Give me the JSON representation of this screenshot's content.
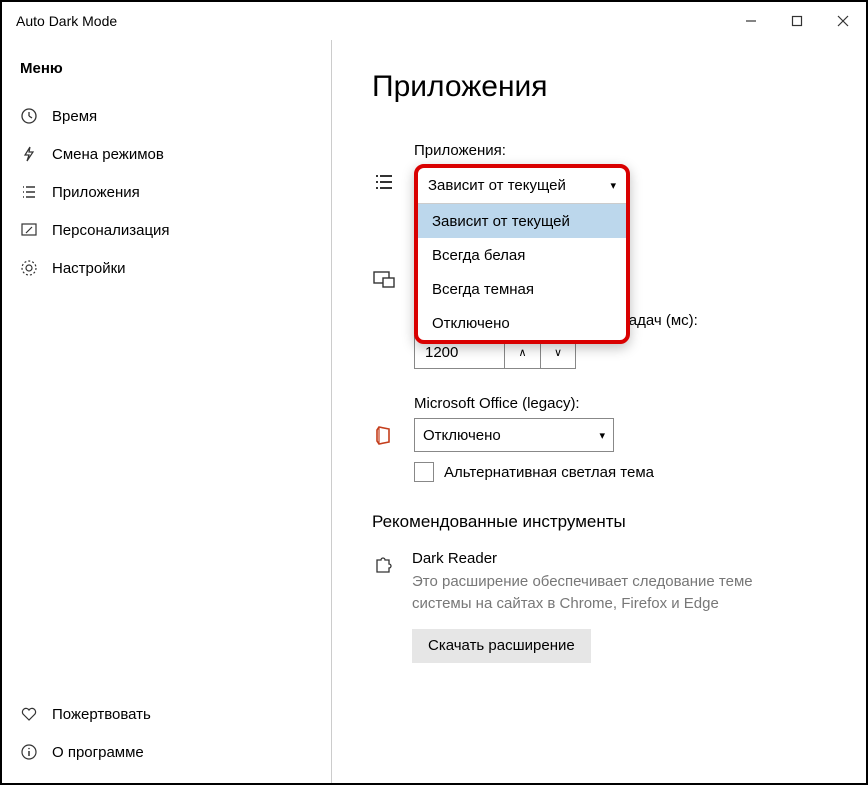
{
  "window": {
    "title": "Auto Dark Mode"
  },
  "sidebar": {
    "header": "Меню",
    "items": [
      {
        "label": "Время"
      },
      {
        "label": "Смена режимов"
      },
      {
        "label": "Приложения"
      },
      {
        "label": "Персонализация"
      },
      {
        "label": "Настройки"
      }
    ],
    "footer": [
      {
        "label": "Пожертвовать"
      },
      {
        "label": "О программе"
      }
    ]
  },
  "page": {
    "title": "Приложения",
    "apps": {
      "label": "Приложения:",
      "selected": "Зависит от текущей",
      "options": [
        "Зависит от текущей",
        "Всегда белая",
        "Всегда темная",
        "Отключено"
      ]
    },
    "taskbar": {
      "label_suffix": " панели задач (мс):",
      "value": "1200"
    },
    "office": {
      "label": "Microsoft Office (legacy):",
      "selected": "Отключено",
      "checkbox_label": "Альтернативная светлая тема"
    },
    "tools": {
      "section_title": "Рекомендованные инструменты",
      "tool_name": "Dark Reader",
      "tool_desc": "Это расширение обеспечивает следование теме системы на сайтах в Chrome, Firefox и Edge",
      "download_label": "Скачать расширение"
    }
  }
}
